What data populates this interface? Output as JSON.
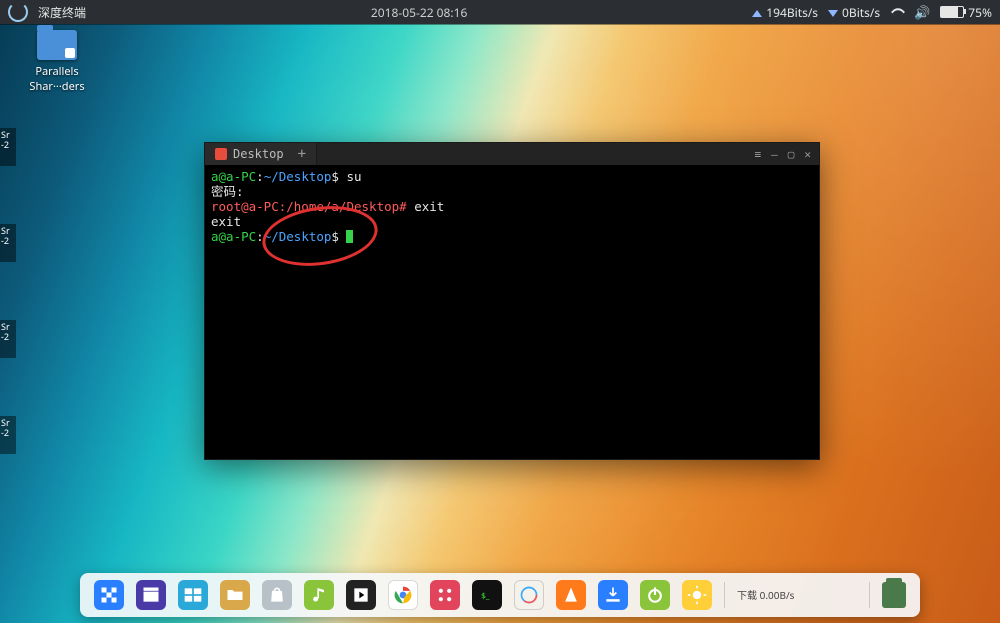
{
  "topbar": {
    "app_name": "深度终端",
    "datetime": "2018-05-22 08:16",
    "net_up": "194Bits/s",
    "net_down": "0Bits/s",
    "battery_pct": "75%"
  },
  "desktop_icons": [
    {
      "label": "Parallels Shar···ders"
    }
  ],
  "side_thumb_label": "Sr\n-2",
  "terminal": {
    "tab_title": "Desktop",
    "lines": [
      {
        "segments": [
          {
            "cls": "g",
            "t": "a@a-PC"
          },
          {
            "cls": "w",
            "t": ":"
          },
          {
            "cls": "b",
            "t": "~/Desktop"
          },
          {
            "cls": "w",
            "t": "$ su"
          }
        ]
      },
      {
        "segments": [
          {
            "cls": "w",
            "t": "密码:"
          }
        ]
      },
      {
        "segments": [
          {
            "cls": "r",
            "t": "root@a-PC:/home/a/Desktop#"
          },
          {
            "cls": "w",
            "t": " exit"
          }
        ]
      },
      {
        "segments": [
          {
            "cls": "w",
            "t": "exit"
          }
        ]
      },
      {
        "segments": [
          {
            "cls": "g",
            "t": "a@a-PC"
          },
          {
            "cls": "w",
            "t": ":"
          },
          {
            "cls": "b",
            "t": "~/Desktop"
          },
          {
            "cls": "w",
            "t": "$ "
          }
        ],
        "cursor": true
      }
    ]
  },
  "dock": {
    "items": [
      {
        "name": "launcher",
        "bg": "#2a7fff",
        "glyph": "grid"
      },
      {
        "name": "deepin-movie",
        "bg": "#4a3aa8",
        "glyph": "clapper"
      },
      {
        "name": "multitask",
        "bg": "#2aa8d8",
        "glyph": "tiles"
      },
      {
        "name": "file-manager",
        "bg": "#d8a84a",
        "glyph": "folder"
      },
      {
        "name": "app-store",
        "bg": "#b8c0c8",
        "glyph": "bag"
      },
      {
        "name": "music",
        "bg": "#8ac43a",
        "glyph": "note"
      },
      {
        "name": "video",
        "bg": "#222",
        "glyph": "film"
      },
      {
        "name": "chrome",
        "bg": "#fff",
        "glyph": "chrome"
      },
      {
        "name": "control-center",
        "bg": "#e2445c",
        "glyph": "dots"
      },
      {
        "name": "terminal",
        "bg": "#111",
        "glyph": "term"
      },
      {
        "name": "clock",
        "bg": "transparent",
        "glyph": "ring"
      },
      {
        "name": "vlc",
        "bg": "#ff7a1a",
        "glyph": "cone"
      },
      {
        "name": "downloads",
        "bg": "#2a7fff",
        "glyph": "dl"
      },
      {
        "name": "power",
        "bg": "#8ac43a",
        "glyph": "power"
      },
      {
        "name": "weather",
        "bg": "#ffcf3a",
        "glyph": "sun"
      }
    ],
    "net_label": "下载\n0.00B/s"
  }
}
